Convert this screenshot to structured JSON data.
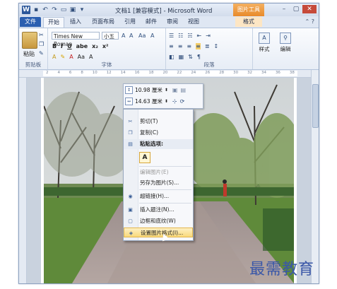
{
  "titlebar": {
    "title": "文档1 [兼容模式] - Microsoft Word",
    "picture_tools": "图片工具"
  },
  "tabs": [
    "文件",
    "开始",
    "插入",
    "页面布局",
    "引用",
    "邮件",
    "审阅",
    "视图",
    "格式"
  ],
  "ribbon": {
    "clipboard": {
      "paste": "粘贴",
      "label": "剪贴板"
    },
    "font": {
      "name": "Times New Roman",
      "size": "小五",
      "label": "字体"
    },
    "paragraph": {
      "label": "段落"
    },
    "styles": {
      "label": "样式"
    },
    "editing": {
      "label": "编辑"
    }
  },
  "minibar": {
    "height": "10.98 厘米",
    "width": "14.63 厘米"
  },
  "context_menu": {
    "cut": "剪切(T)",
    "copy": "复制(C)",
    "paste_options": "粘贴选项:",
    "paste_glyph": "A",
    "edit_picture": "编辑图片(E)",
    "save_as_picture": "另存为图片(S)...",
    "hyperlink": "超链接(H)...",
    "insert_caption": "插入题注(N)...",
    "wrap_text": "边框和底纹(W)",
    "format_picture": "设置图片格式(I)..."
  },
  "ruler_ticks": [
    "2",
    "4",
    "6",
    "8",
    "10",
    "12",
    "14",
    "16",
    "18",
    "20",
    "22",
    "24",
    "26",
    "28",
    "30",
    "32",
    "34",
    "36",
    "38"
  ],
  "watermark": "最需教育",
  "colors": {
    "accent": "#2b5fb0",
    "picture_tools": "#e88a2a",
    "highlight": "#f9d97b"
  }
}
